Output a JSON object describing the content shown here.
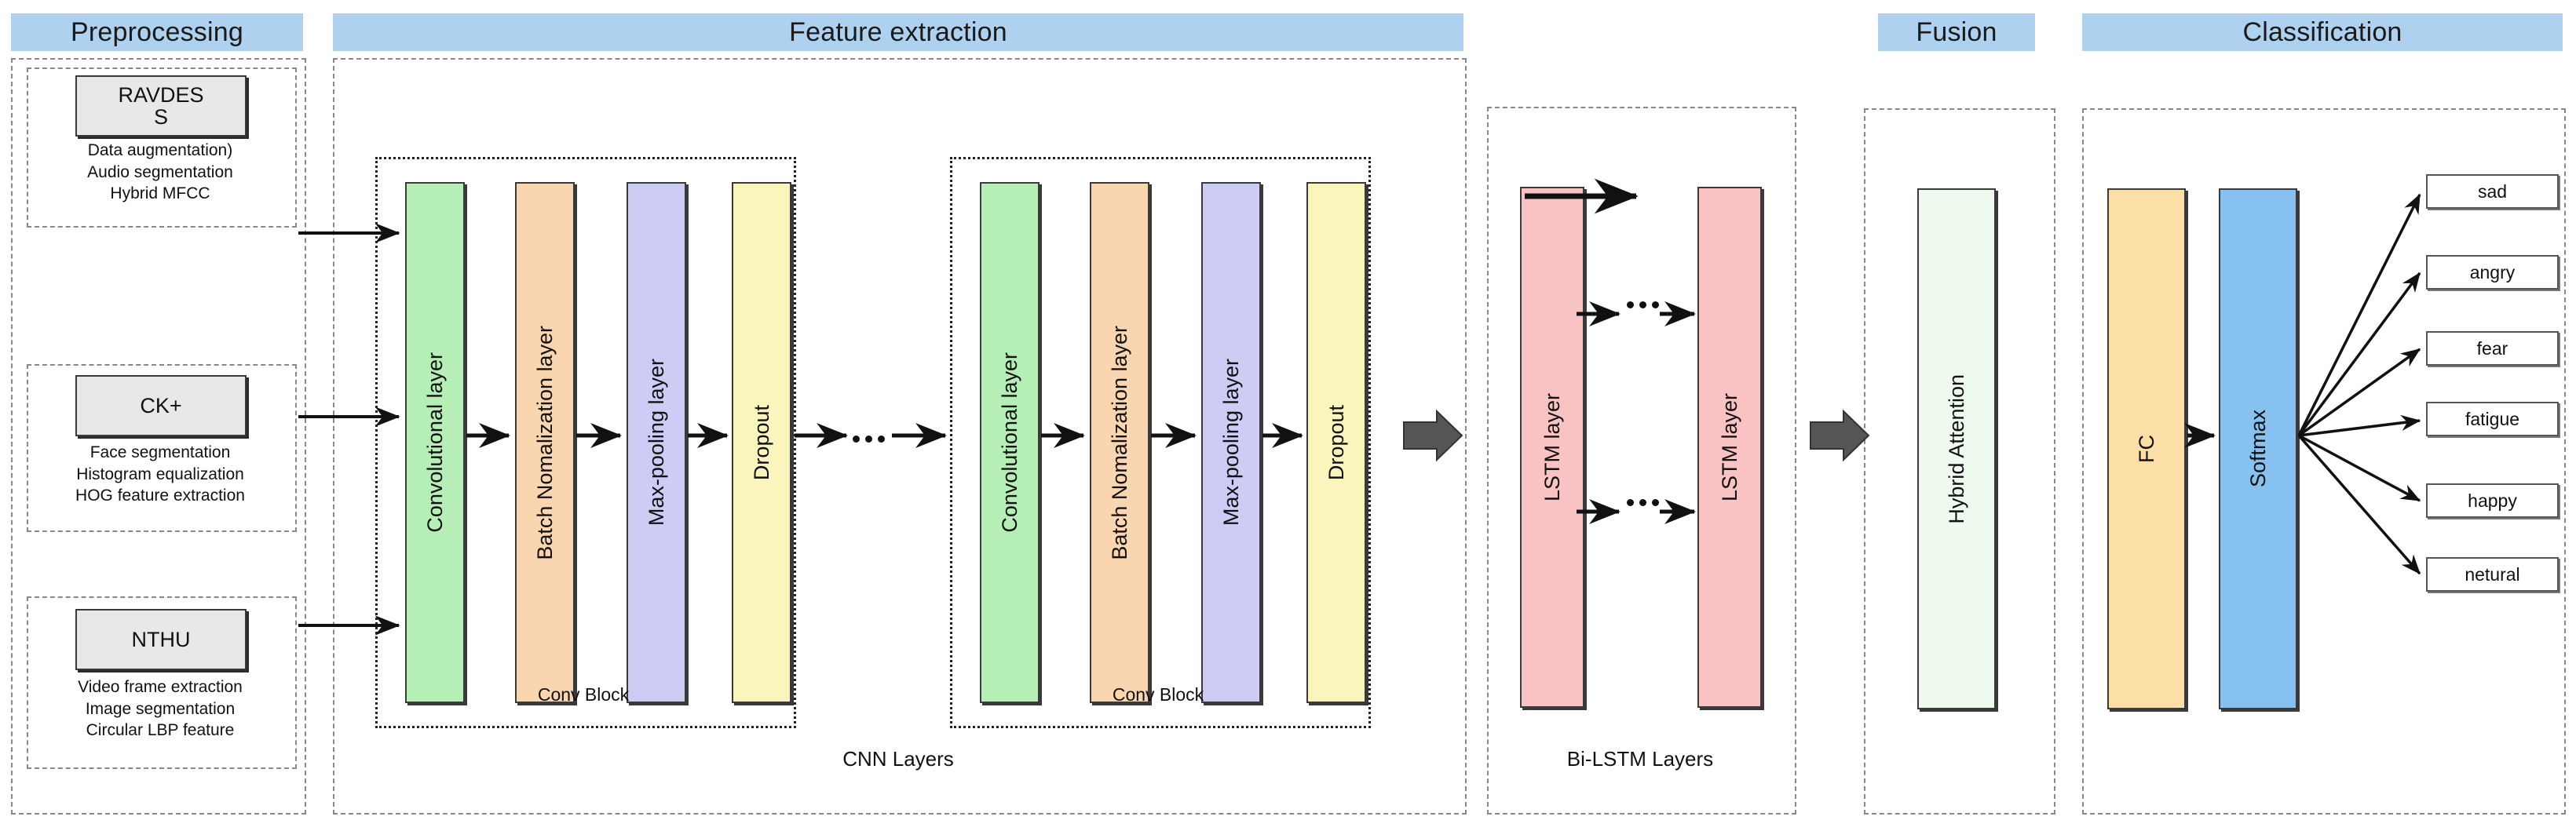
{
  "headers": {
    "preprocessing": "Preprocessing",
    "feature_extraction": "Feature extraction",
    "fusion": "Fusion",
    "classification": "Classification"
  },
  "preprocessing": {
    "datasets": [
      {
        "name": "RAVDESS",
        "name_line1": "RAVDES",
        "name_line2": "S",
        "steps": [
          "Data augmentation)",
          "Audio segmentation",
          "Hybrid MFCC"
        ]
      },
      {
        "name": "CK+",
        "name_line1": "CK+",
        "name_line2": "",
        "steps": [
          "Face segmentation",
          "Histogram equalization",
          "HOG feature extraction"
        ]
      },
      {
        "name": "NTHU",
        "name_line1": "NTHU",
        "name_line2": "",
        "steps": [
          "Video frame extraction",
          "Image segmentation",
          "Circular LBP feature"
        ]
      }
    ]
  },
  "cnn": {
    "group_label": "CNN Layers",
    "block_label": "Conv Block",
    "blocks": [
      {
        "layers": [
          {
            "label": "Convolutional layer",
            "color": "#b6efb6"
          },
          {
            "label": "Batch Nomalization layer",
            "color": "#fad6b0"
          },
          {
            "label": "Max-pooling layer",
            "color": "#ccccf4"
          },
          {
            "label": "Dropout",
            "color": "#f9f5bd"
          }
        ]
      },
      {
        "layers": [
          {
            "label": "Convolutional layer",
            "color": "#b6efb6"
          },
          {
            "label": "Batch Nomalization layer",
            "color": "#fad6b0"
          },
          {
            "label": "Max-pooling layer",
            "color": "#ccccf4"
          },
          {
            "label": "Dropout",
            "color": "#f9f5bd"
          }
        ]
      }
    ]
  },
  "bilstm": {
    "group_label": "Bi-LSTM Layers",
    "layers": [
      {
        "label": "LSTM layer",
        "color": "#f9c3c3"
      },
      {
        "label": "LSTM layer",
        "color": "#f9c3c3"
      }
    ]
  },
  "fusion": {
    "block": {
      "label": "Hybrid Attention",
      "color": "#effaef"
    }
  },
  "classification": {
    "blocks": [
      {
        "label": "FC",
        "color": "#fbdfa6"
      },
      {
        "label": "Softmax",
        "color": "#86c1ef"
      }
    ],
    "outputs": [
      "sad",
      "angry",
      "fear",
      "fatigue",
      "happy",
      "netural"
    ]
  },
  "colors": {
    "header_bar": "#aed1f0",
    "dataset_box": "#e8e8e8",
    "arrow": "#111111",
    "big_arrow": "#555555"
  }
}
